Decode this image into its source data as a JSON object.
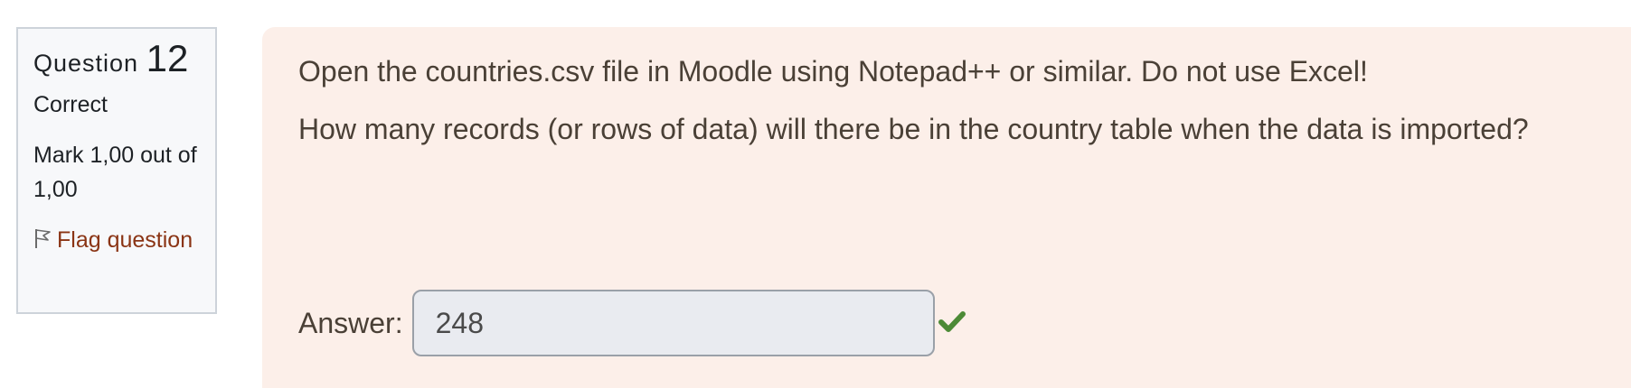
{
  "info": {
    "question_word": "Question",
    "question_number": "12",
    "state": "Correct",
    "grade": "Mark 1,00 out of 1,00",
    "flag_label": "Flag question",
    "flag_icon": "flag-icon"
  },
  "question": {
    "text_1": "Open the countries.csv file in Moodle using Notepad++ or similar. Do not use Excel!",
    "text_2": "How many records (or rows of data) will there be in the country table when the data is imported?",
    "answer_label": "Answer:",
    "answer_value": "248",
    "result_icon": "check-icon"
  },
  "colors": {
    "content_bg": "#fcefe9",
    "info_bg": "#f7f8fa",
    "flag_link": "#8a3414",
    "correct_green": "#4c8a36"
  }
}
